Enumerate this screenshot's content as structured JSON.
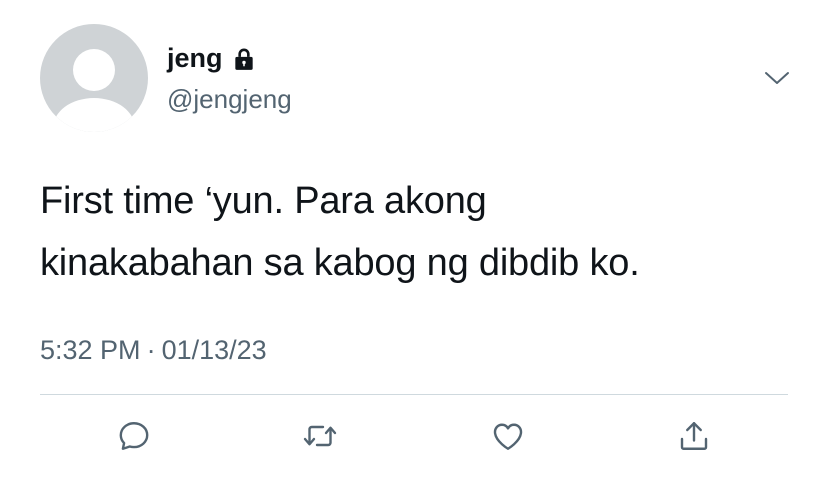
{
  "user": {
    "display_name": "jeng",
    "handle": "@jengjeng",
    "protected": true
  },
  "tweet": {
    "text": "First time ‘yun. Para akong\nkinakabahan sa kabog ng dibdib ko.",
    "time": "5:32 PM",
    "separator": "·",
    "date": "01/13/23"
  },
  "icons": {
    "lock": "lock-icon",
    "menu": "chevron-down-icon",
    "reply": "reply-icon",
    "retweet": "retweet-icon",
    "like": "heart-icon",
    "share": "share-icon"
  },
  "colors": {
    "text_primary": "#0f1419",
    "text_secondary": "#536471",
    "icon": "#536471",
    "avatar_bg": "#cfd3d6",
    "divider": "#cfd9de"
  }
}
